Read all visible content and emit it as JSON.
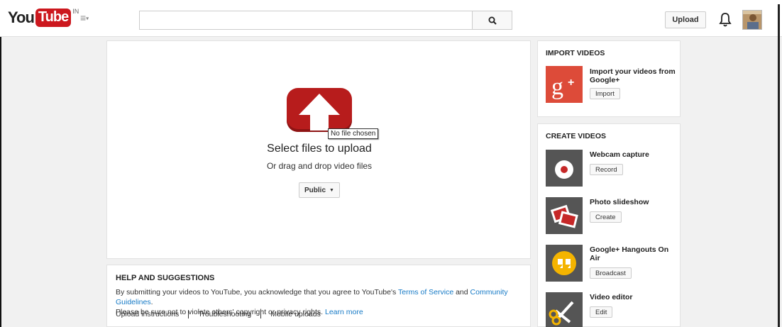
{
  "header": {
    "logo_you": "You",
    "logo_tube": "Tube",
    "logo_region": "IN",
    "search_placeholder": "",
    "upload_label": "Upload"
  },
  "upload": {
    "file_tooltip": "No file chosen",
    "title": "Select files to upload",
    "subtitle": "Or drag and drop video files",
    "privacy_label": "Public"
  },
  "help": {
    "title": "HELP AND SUGGESTIONS",
    "text_1": "By submitting your videos to YouTube, you acknowledge that you agree to YouTube's ",
    "terms_link": "Terms of Service",
    "text_2": " and ",
    "guidelines_link": "Community Guidelines",
    "text_3": ".",
    "text_4": "Please be sure not to violate others' copyright or privacy rights. ",
    "learn_more": "Learn more",
    "links": [
      "Upload instructions",
      "Troubleshooting",
      "Mobile uploads"
    ]
  },
  "import": {
    "title": "IMPORT VIDEOS",
    "item_label": "Import your videos from Google+",
    "item_button": "Import"
  },
  "create": {
    "title": "CREATE VIDEOS",
    "items": [
      {
        "label": "Webcam capture",
        "button": "Record"
      },
      {
        "label": "Photo slideshow",
        "button": "Create"
      },
      {
        "label": "Google+ Hangouts On Air",
        "button": "Broadcast"
      },
      {
        "label": "Video editor",
        "button": "Edit"
      }
    ]
  },
  "colors": {
    "brand_red": "#cc181e",
    "upload_red": "#b71c1c",
    "link_blue": "#167ac6",
    "google_plus_red": "#dd4b39",
    "hangouts_yellow": "#f4b400"
  }
}
